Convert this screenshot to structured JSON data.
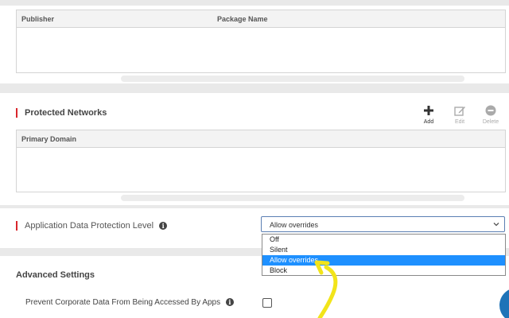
{
  "apps_panel": {
    "columns": [
      "Publisher",
      "Package Name"
    ]
  },
  "networks_panel": {
    "title": "Protected Networks",
    "actions": {
      "add": "Add",
      "edit": "Edit",
      "delete": "Delete"
    },
    "columns": [
      "Primary Domain"
    ]
  },
  "protection": {
    "label": "Application Data Protection Level",
    "selected": "Allow overrides",
    "options": [
      "Off",
      "Silent",
      "Allow overrides",
      "Block"
    ]
  },
  "advanced": {
    "title": "Advanced Settings",
    "prevent_label": "Prevent Corporate Data From Being Accessed By Apps",
    "prevent_checked": false
  },
  "colors": {
    "accent_red": "#d9262c",
    "selection_blue": "#1e90ff",
    "annotation_yellow": "#f2e41a"
  }
}
